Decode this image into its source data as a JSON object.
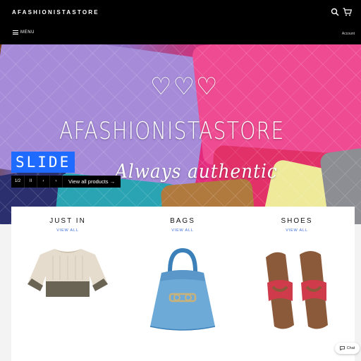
{
  "header": {
    "store_name": "AFASHIONISTASTORE",
    "menu_label": "MENU",
    "account_label": "Account",
    "icons": [
      "search-icon",
      "cart-icon",
      "hamburger-icon"
    ]
  },
  "hero": {
    "hearts": "♡♡♡",
    "title": "AFASHIONISTASTORE",
    "tagline": "Always authentic",
    "slide_label": "SLIDE",
    "controls": {
      "counter": "1/2",
      "pause": "II",
      "prev": "‹",
      "next": "›",
      "view_all": "View all products →"
    }
  },
  "collections": [
    {
      "title": "JUST IN",
      "link": "VIEW ALL",
      "image": "sweater"
    },
    {
      "title": "BAGS",
      "link": "VIEW ALL",
      "image": "handbag"
    },
    {
      "title": "SHOES",
      "link": "VIEW ALL",
      "image": "sandals"
    }
  ],
  "chat": {
    "label": "Chat"
  },
  "colors": {
    "header_bg": "#000000",
    "accent_blue": "#1f6bff",
    "link_blue": "#3d6fd6"
  }
}
